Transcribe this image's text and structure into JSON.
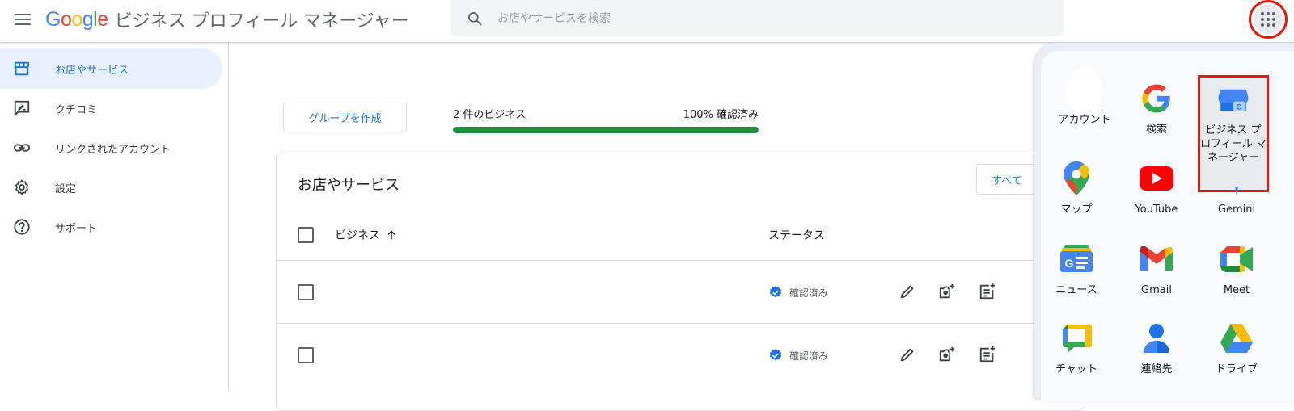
{
  "header": {
    "logo_google": "Google",
    "title": "ビジネス プロフィール マネージャー",
    "search_placeholder": "お店やサービスを検索"
  },
  "sidebar": {
    "items": [
      {
        "label": "お店やサービス",
        "icon": "storefront-icon",
        "active": true
      },
      {
        "label": "クチコミ",
        "icon": "review-icon",
        "active": false
      },
      {
        "label": "リンクされたアカウント",
        "icon": "link-icon",
        "active": false
      },
      {
        "label": "設定",
        "icon": "gear-icon",
        "active": false
      },
      {
        "label": "サポート",
        "icon": "help-icon",
        "active": false
      }
    ]
  },
  "main": {
    "group_button": "グループを作成",
    "business_count": "2 件のビジネス",
    "verified_pct_label": "100% 確認済み",
    "verified_fraction": 1.0,
    "card_title": "お店やサービス",
    "all_button": "すべて",
    "columns": {
      "business": "ビジネス",
      "status": "ステータス"
    },
    "rows": [
      {
        "status": "確認済み"
      },
      {
        "status": "確認済み"
      }
    ]
  },
  "apps_panel": {
    "apps": [
      {
        "name": "アカウント",
        "icon": "account-avatar-icon"
      },
      {
        "name": "検索",
        "icon": "google-g-icon"
      },
      {
        "name": "ビジネス プロフィール マネージャー",
        "icon": "business-profile-icon",
        "highlighted": true
      },
      {
        "name": "マップ",
        "icon": "maps-pin-icon"
      },
      {
        "name": "YouTube",
        "icon": "youtube-icon"
      },
      {
        "name": "Gemini",
        "icon": "gemini-icon"
      },
      {
        "name": "ニュース",
        "icon": "news-icon"
      },
      {
        "name": "Gmail",
        "icon": "gmail-icon"
      },
      {
        "name": "Meet",
        "icon": "meet-icon"
      },
      {
        "name": "チャット",
        "icon": "chat-icon"
      },
      {
        "name": "連絡先",
        "icon": "contacts-icon"
      },
      {
        "name": "ドライブ",
        "icon": "drive-icon"
      }
    ]
  },
  "colors": {
    "accent": "#1a73e8",
    "progress": "#1e8e3e",
    "highlight": "#e8170c"
  }
}
